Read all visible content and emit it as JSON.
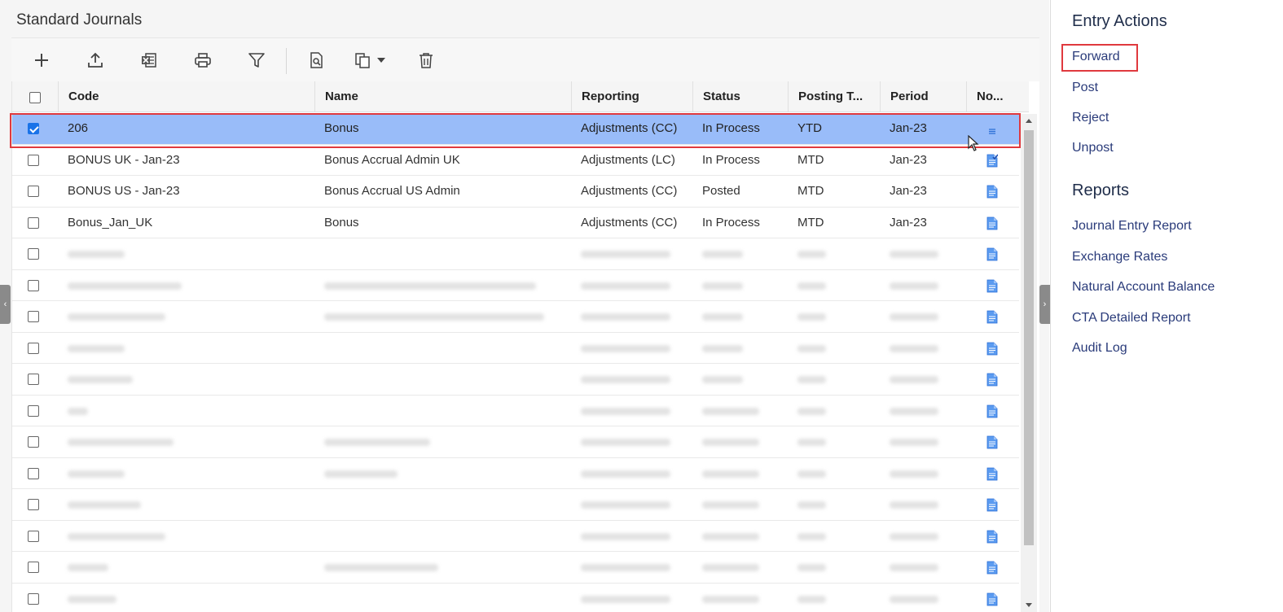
{
  "page": {
    "title": "Standard Journals"
  },
  "toolbar": {
    "buttons": [
      {
        "name": "add-icon"
      },
      {
        "name": "upload-icon"
      },
      {
        "name": "excel-export-icon"
      },
      {
        "name": "print-icon"
      },
      {
        "name": "filter-icon"
      },
      {
        "name": "document-search-icon"
      },
      {
        "name": "copy-dropdown-icon"
      },
      {
        "name": "delete-icon"
      }
    ]
  },
  "grid": {
    "columns": [
      "Code",
      "Name",
      "Reporting",
      "Status",
      "Posting T...",
      "Period",
      "No..."
    ],
    "rows": [
      {
        "selected": true,
        "code": "206",
        "name": "Bonus",
        "reporting": "Adjustments (CC)",
        "status": "In Process",
        "posting": "YTD",
        "period": "Jan-23",
        "note_icon": "note-lines-icon"
      },
      {
        "selected": false,
        "code": "BONUS UK - Jan-23",
        "name": "Bonus Accrual Admin UK",
        "reporting": "Adjustments (LC)",
        "status": "In Process",
        "posting": "MTD",
        "period": "Jan-23",
        "note_icon": "document-check-icon"
      },
      {
        "selected": false,
        "code": "BONUS US - Jan-23",
        "name": "Bonus Accrual US Admin",
        "reporting": "Adjustments (CC)",
        "status": "Posted",
        "posting": "MTD",
        "period": "Jan-23",
        "note_icon": "document-icon"
      },
      {
        "selected": false,
        "code": "Bonus_Jan_UK",
        "name": "Bonus",
        "reporting": "Adjustments (CC)",
        "status": "In Process",
        "posting": "MTD",
        "period": "Jan-23",
        "note_icon": "document-icon"
      }
    ],
    "blurred_row_count": 12
  },
  "side": {
    "entry_actions": {
      "heading": "Entry Actions",
      "items": [
        "Forward",
        "Post",
        "Reject",
        "Unpost"
      ]
    },
    "reports": {
      "heading": "Reports",
      "items": [
        "Journal Entry Report",
        "Exchange Rates",
        "Natural Account Balance",
        "CTA Detailed Report",
        "Audit Log"
      ]
    }
  },
  "colors": {
    "selected_row": "#99bcf9",
    "highlight": "#e0393e",
    "link": "#2a3b7a",
    "checkbox": "#1a73e8"
  }
}
